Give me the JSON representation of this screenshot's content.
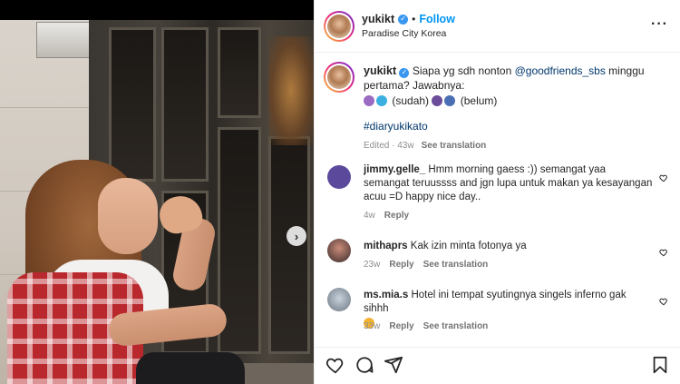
{
  "post": {
    "author": {
      "username": "yukikt",
      "verified": true,
      "follow_label": "Follow",
      "location": "Paradise City Korea"
    },
    "more_icon": "more-horizontal-icon",
    "caption": {
      "username": "yukikt",
      "text_before_mention": "Siapa yg sdh nonton ",
      "mention": "@goodfriends_sbs",
      "text_after_mention": " minggu pertama? Jawabnya:",
      "line2_a": "(sudah)",
      "line2_b": "(belum)",
      "hashtag": "#diaryukikato",
      "edited": "Edited · 43w",
      "see_translation": "See translation"
    },
    "next_icon": "chevron-right-icon"
  },
  "comments": [
    {
      "username": "jimmy.gelle_",
      "text": "Hmm morning gaess :)) semangat yaa semangat teruussss and jgn lupa untuk makan ya kesayangan acuu =D happy nice day..",
      "time": "4w",
      "reply": "Reply",
      "see_translation": "",
      "avatar_color": "#5b4a9c"
    },
    {
      "username": "mithaprs",
      "text": "Kak izin minta fotonya ya",
      "time": "23w",
      "reply": "Reply",
      "see_translation": "See translation",
      "avatar_color": "#3a2a2a"
    },
    {
      "username": "ms.mia.s",
      "text": "Hotel ini tempat syutingnya singels inferno gak sihhh",
      "time": "33w",
      "reply": "Reply",
      "see_translation": "See translation",
      "avatar_color": "#8a8f96"
    }
  ],
  "actions": {
    "like_icon": "heart-icon",
    "comment_icon": "comment-icon",
    "share_icon": "send-icon",
    "save_icon": "bookmark-icon"
  },
  "colors": {
    "link": "#0095f6",
    "mention": "#00376b",
    "muted": "#8e8e8e"
  }
}
